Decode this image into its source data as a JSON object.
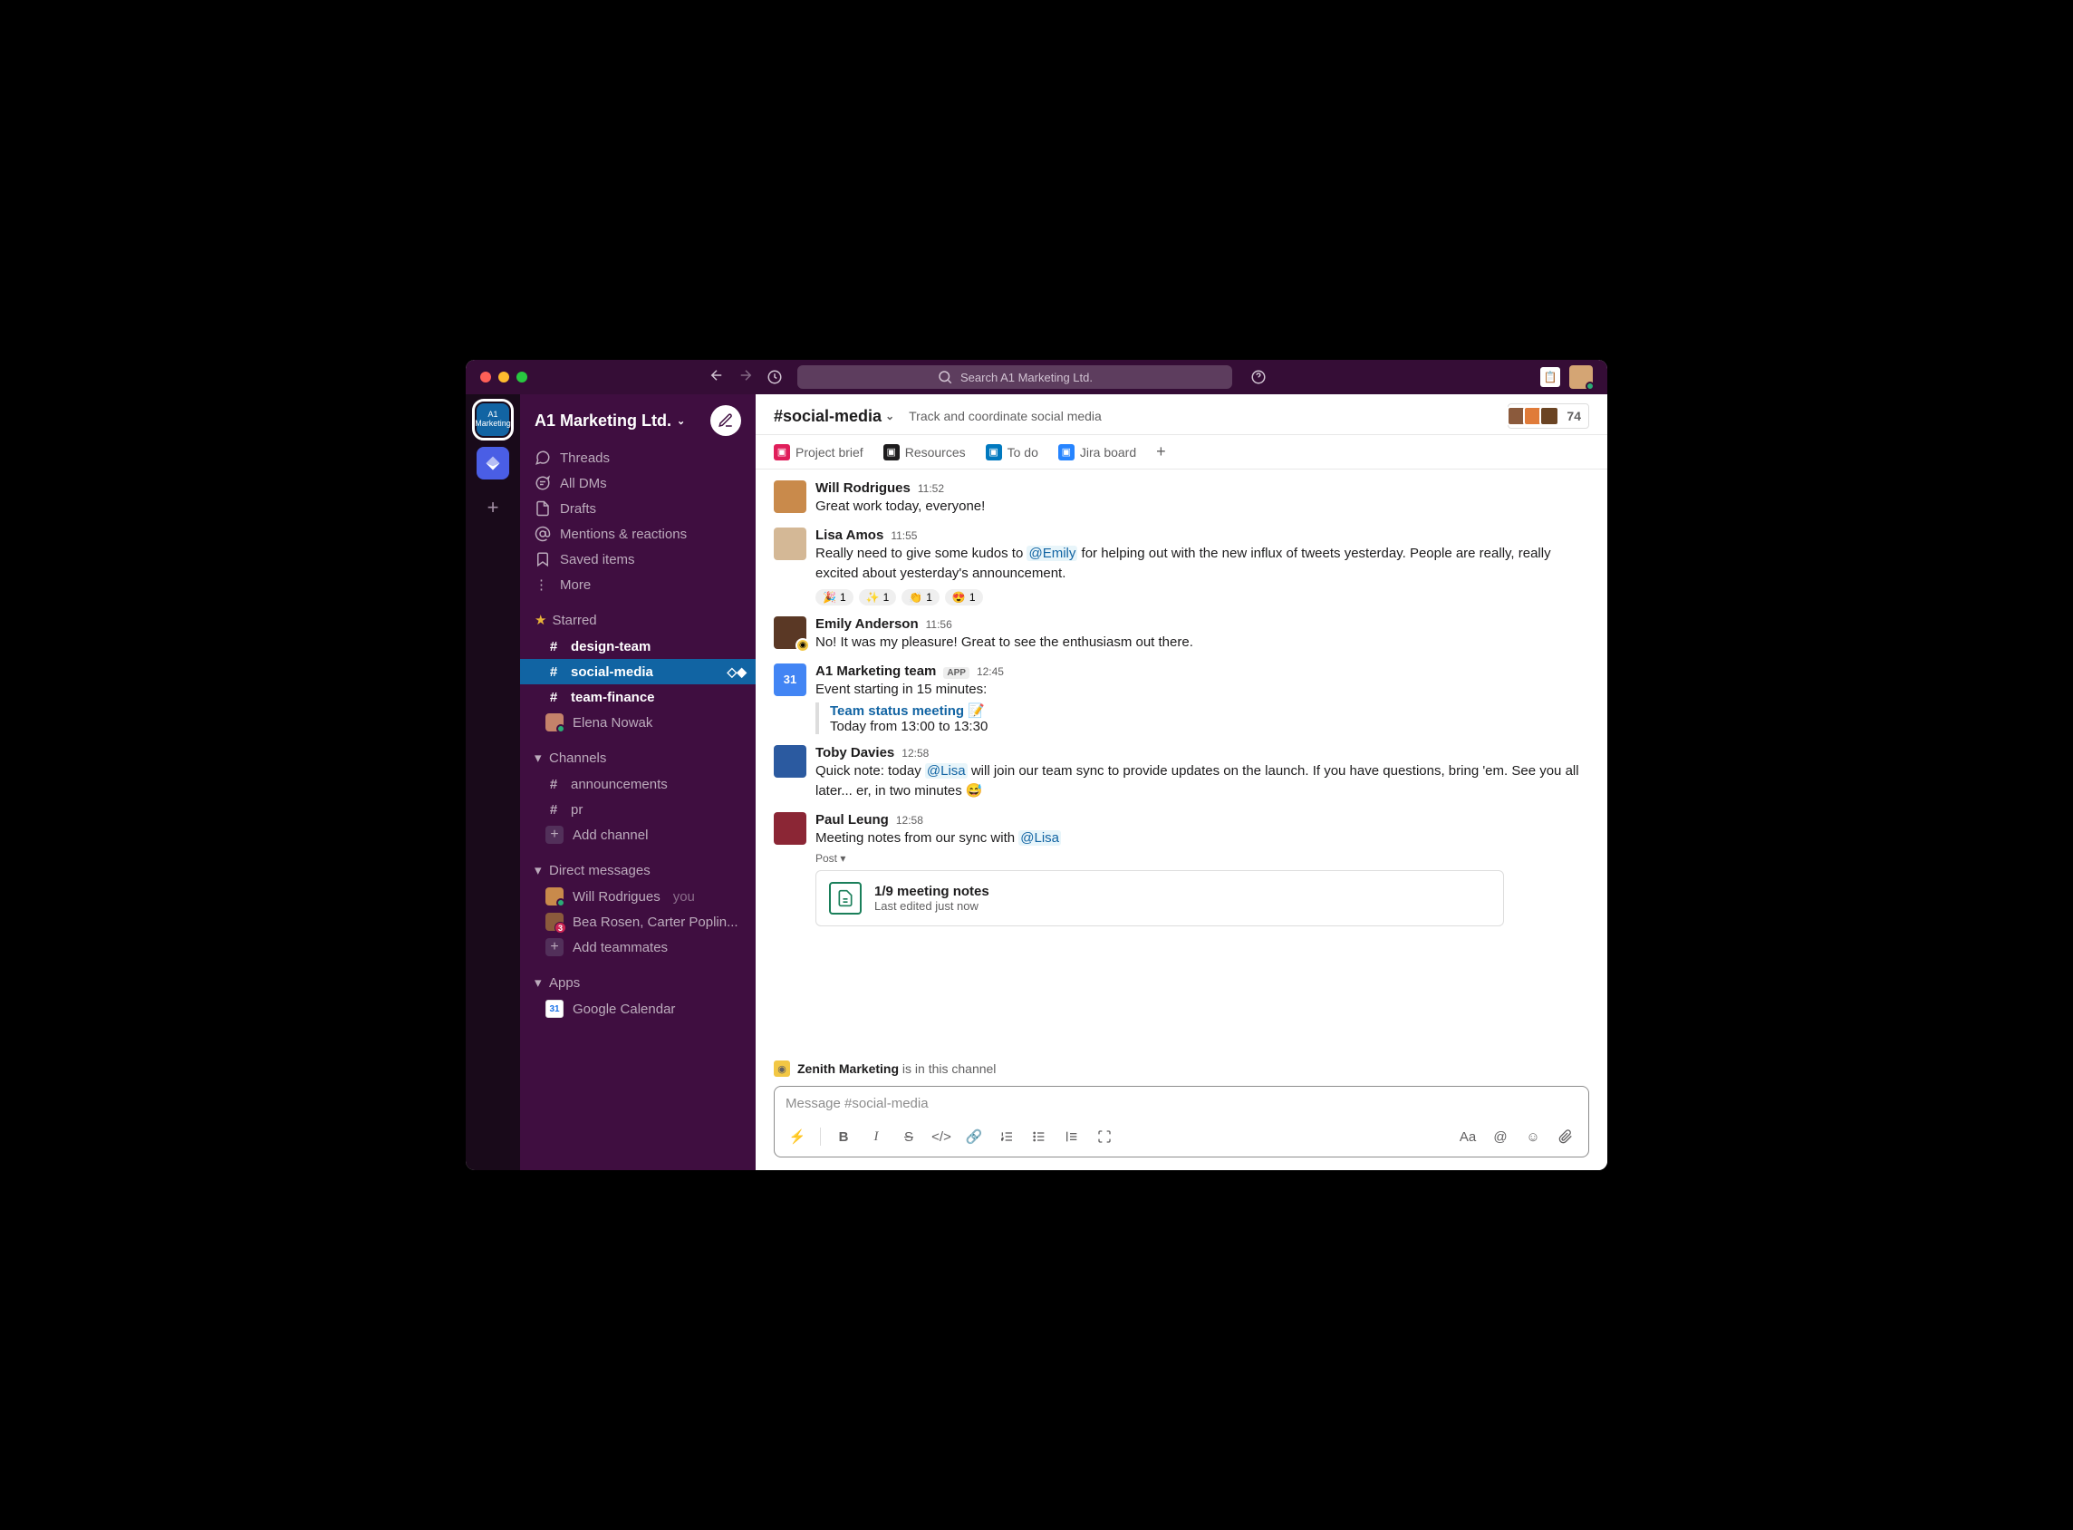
{
  "search": {
    "placeholder": "Search A1 Marketing Ltd."
  },
  "workspace": {
    "name": "A1 Marketing Ltd."
  },
  "rail": {
    "ws_label": "A1\nMarketing"
  },
  "nav": {
    "threads": "Threads",
    "all_dms": "All DMs",
    "drafts": "Drafts",
    "mentions": "Mentions & reactions",
    "saved": "Saved items",
    "more": "More"
  },
  "sections": {
    "starred": "Starred",
    "channels": "Channels",
    "dms": "Direct messages",
    "apps": "Apps"
  },
  "starred_channels": [
    "design-team",
    "social-media",
    "team-finance"
  ],
  "starred_dms": [
    {
      "name": "Elena Nowak"
    }
  ],
  "channels": [
    "announcements",
    "pr"
  ],
  "add_channel": "Add channel",
  "dms": [
    {
      "name": "Will Rodrigues",
      "you_label": "you"
    },
    {
      "name": "Bea Rosen, Carter Poplin...",
      "badge": "3"
    }
  ],
  "add_teammates": "Add teammates",
  "apps": [
    {
      "name": "Google Calendar"
    }
  ],
  "channel_header": {
    "name": "#social-media",
    "topic": "Track and coordinate social media",
    "member_count": "74"
  },
  "bookmarks": [
    {
      "label": "Project brief",
      "color": "#e01e5a"
    },
    {
      "label": "Resources",
      "color": "#1d1c1d"
    },
    {
      "label": "To do",
      "color": "#0079bf"
    },
    {
      "label": "Jira board",
      "color": "#2684ff"
    }
  ],
  "messages": [
    {
      "author": "Will Rodrigues",
      "time": "11:52",
      "avatar": "#c98a4b",
      "text": "Great work today, everyone!"
    },
    {
      "author": "Lisa Amos",
      "time": "11:55",
      "avatar": "#d4b896",
      "text_parts": [
        "Really need to give some kudos to ",
        {
          "mention": "@Emily"
        },
        " for helping out with the new influx of tweets yesterday. People are really, really excited about yesterday's announcement."
      ],
      "reactions": [
        {
          "e": "🎉",
          "c": "1"
        },
        {
          "e": "✨",
          "c": "1"
        },
        {
          "e": "👏",
          "c": "1"
        },
        {
          "e": "😍",
          "c": "1"
        }
      ]
    },
    {
      "author": "Emily Anderson",
      "time": "11:56",
      "avatar": "#5a3825",
      "status_emoji": true,
      "text": "No! It was my pleasure! Great to see the enthusiasm out there."
    },
    {
      "author": "A1 Marketing team",
      "time": "12:45",
      "app": "APP",
      "avatar": "#4285f4",
      "avatar_text": "31",
      "text": "Event starting in 15 minutes:",
      "event": {
        "title": "Team status meeting",
        "emoji": "📝",
        "time": "Today from 13:00 to 13:30"
      }
    },
    {
      "author": "Toby Davies",
      "time": "12:58",
      "avatar": "#2b5aa0",
      "text_parts": [
        "Quick note: today ",
        {
          "mention": "@Lisa"
        },
        " will join our team sync to provide updates on the launch. If you have questions, bring 'em. See you all later... er, in two minutes 😅"
      ]
    },
    {
      "author": "Paul Leung",
      "time": "12:58",
      "avatar": "#8b2635",
      "text_parts": [
        "Meeting notes from our sync with ",
        {
          "mention": "@Lisa"
        }
      ],
      "post_label": "Post ▾",
      "file": {
        "title": "1/9 meeting notes",
        "sub": "Last edited just now"
      }
    }
  ],
  "org_notice": {
    "org": "Zenith Marketing",
    "suffix": " is in this channel"
  },
  "composer": {
    "placeholder": "Message #social-media"
  }
}
